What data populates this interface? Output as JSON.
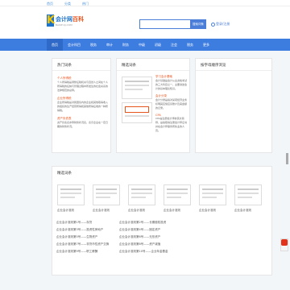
{
  "top_links": [
    "首页",
    "分类",
    "热门"
  ],
  "logo": {
    "main": "会计网",
    "highlight": "百科",
    "sub": "BAIKE.KJ.COM"
  },
  "search": {
    "placeholder": "",
    "button": "搜索词条"
  },
  "login": {
    "label": "登录/注册"
  },
  "nav": [
    "首页",
    "会计科目",
    "税务",
    "审计",
    "财务",
    "中级",
    "初级",
    "注会",
    "税务",
    "更多"
  ],
  "panels": {
    "left_title": "热门词条",
    "middle_title": "精选词条",
    "right_title": "按字母顺序浏览"
  },
  "left_items": [
    {
      "title": "个人所得税",
      "text": "个人所得税是调整征税机关与自然人之间在个人所得税的征纳与管理过程中所发生的社会关系的法律规范的总称。"
    },
    {
      "title": "企业所得税",
      "text": "企业所得税是对我国境内的企业和其他取得收入的组织的生产经营所得和其他所得征收的一种所得税。"
    },
    {
      "title": "资产负债表",
      "text": "资产负债表亦称财务状况表，表示企业在一定日期的财务状况。"
    }
  ],
  "middle_items": [
    {
      "title": "学习会计基础",
      "text": "会计基础是会计从业资格考试的三大科目之一，主要讲述会计的基本理论知识。"
    },
    {
      "title": "会计分录",
      "text": "会计分录是指对某项经济业务标明其应借应贷账户及其金额的记录。"
    },
    {
      "title": "CPA",
      "text": "CPA是注册会计师的英文简称，是指取得注册会计师证书并在会计师事务所执业的人员。"
    }
  ],
  "bottom_title": "精选词条",
  "bottom_images": [
    "会计分录",
    "会计分录",
    "会计分录",
    "会计分录",
    "会计分录",
    "会计分录"
  ],
  "bottom_labels": [
    "企业会计准则",
    "企业会计准则",
    "企业会计准则",
    "企业会计准则",
    "企业会计准则",
    "企业会计准则"
  ],
  "list_rows": [
    [
      "企业会计准则第1号——存货",
      "企业会计准则第2号——长期股权投资"
    ],
    [
      "企业会计准则第3号——投资性房地产",
      "企业会计准则第4号——固定资产"
    ],
    [
      "企业会计准则第5号——生物资产",
      "企业会计准则第6号——无形资产"
    ],
    [
      "企业会计准则第7号——非货币性资产交换",
      "企业会计准则第8号——资产减值"
    ],
    [
      "企业会计准则第9号——职工薪酬",
      "企业会计准则第10号——企业年金基金"
    ]
  ]
}
